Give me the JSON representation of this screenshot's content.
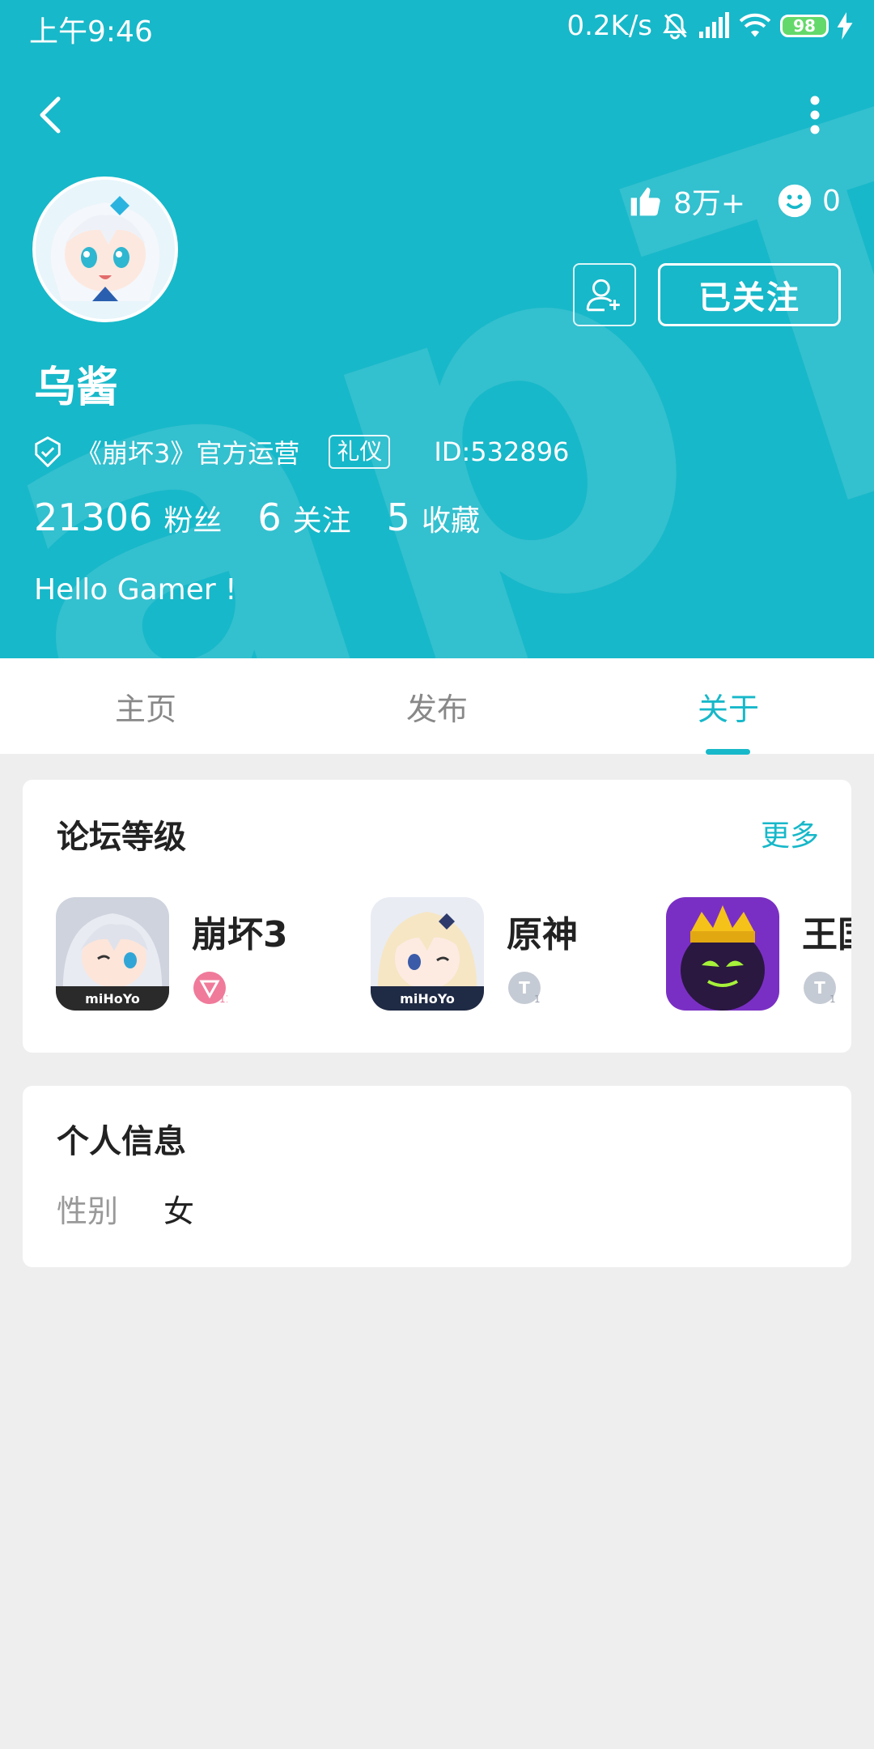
{
  "status_bar": {
    "time": "上午9:46",
    "network_speed": "0.2K/s",
    "battery": "98"
  },
  "profile": {
    "username": "乌酱",
    "likes": "8万+",
    "smiles": "0",
    "follow_button_label": "已关注",
    "certification": "《崩坏3》官方运营",
    "tag": "礼仪",
    "user_id": "ID:532896",
    "counts": [
      {
        "value": "21306",
        "label": "粉丝"
      },
      {
        "value": "6",
        "label": "关注"
      },
      {
        "value": "5",
        "label": "收藏"
      }
    ],
    "bio": "Hello Gamer !"
  },
  "tabs": [
    {
      "label": "主页",
      "active": false
    },
    {
      "label": "发布",
      "active": false
    },
    {
      "label": "关于",
      "active": true
    }
  ],
  "forum_level": {
    "title": "论坛等级",
    "more_label": "更多",
    "items": [
      {
        "name": "崩坏3",
        "icon": "honkai-game-icon",
        "badge_color": "#f07a9a"
      },
      {
        "name": "原神",
        "icon": "genshin-game-icon",
        "badge_color": "#c5cbd4"
      },
      {
        "name": "王国",
        "icon": "kingdom-game-icon",
        "badge_color": "#c5cbd4"
      }
    ]
  },
  "personal_info": {
    "title": "个人信息",
    "gender_label": "性别",
    "gender_value": "女"
  },
  "colors": {
    "accent": "#17b8c9",
    "background": "#eeeeee"
  }
}
